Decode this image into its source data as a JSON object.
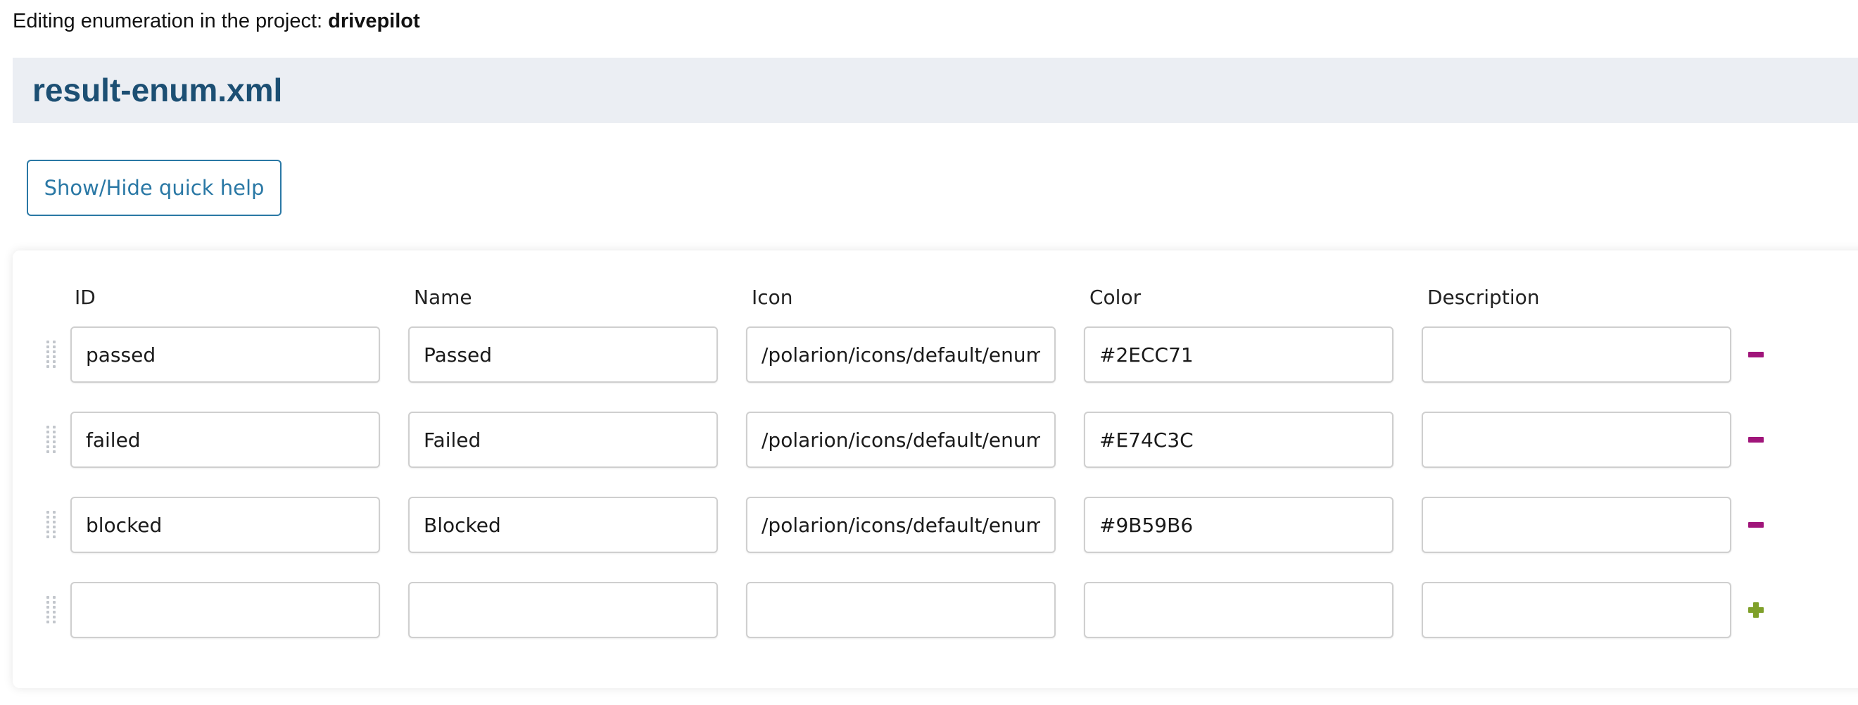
{
  "header": {
    "project_prefix": "Editing enumeration in the project: ",
    "project_name": "drivepilot"
  },
  "title": "result-enum.xml",
  "help_button_label": "Show/Hide quick help",
  "columns": {
    "id": "ID",
    "name": "Name",
    "icon": "Icon",
    "color": "Color",
    "description": "Description"
  },
  "rows": [
    {
      "id": "passed",
      "name": "Passed",
      "icon": "/polarion/icons/default/enums/",
      "color": "#2ECC71",
      "description": ""
    },
    {
      "id": "failed",
      "name": "Failed",
      "icon": "/polarion/icons/default/enums/",
      "color": "#E74C3C",
      "description": ""
    },
    {
      "id": "blocked",
      "name": "Blocked",
      "icon": "/polarion/icons/default/enums/",
      "color": "#9B59B6",
      "description": ""
    },
    {
      "id": "",
      "name": "",
      "icon": "",
      "color": "",
      "description": ""
    }
  ],
  "icons": {
    "remove": "minus-icon",
    "add": "plus-icon",
    "drag": "drag-handle-icon"
  },
  "colors": {
    "title": "#1c4f73",
    "title_bar_bg": "#ebeef3",
    "button_accent": "#2a78a5",
    "remove": "#a0157a",
    "add": "#7fa02a"
  }
}
